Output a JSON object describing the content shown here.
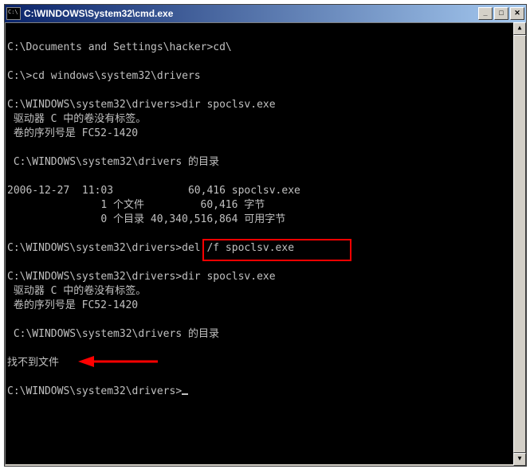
{
  "window": {
    "title": "C:\\WINDOWS\\System32\\cmd.exe"
  },
  "terminal": {
    "lines": [
      "",
      "C:\\Documents and Settings\\hacker>cd\\",
      "",
      "C:\\>cd windows\\system32\\drivers",
      "",
      "C:\\WINDOWS\\system32\\drivers>dir spoclsv.exe",
      " 驱动器 C 中的卷没有标签。",
      " 卷的序列号是 FC52-1420",
      "",
      " C:\\WINDOWS\\system32\\drivers 的目录",
      "",
      "2006-12-27  11:03            60,416 spoclsv.exe",
      "               1 个文件         60,416 字节",
      "               0 个目录 40,340,516,864 可用字节",
      "",
      "C:\\WINDOWS\\system32\\drivers>del /f spoclsv.exe",
      "",
      "C:\\WINDOWS\\system32\\drivers>dir spoclsv.exe",
      " 驱动器 C 中的卷没有标签。",
      " 卷的序列号是 FC52-1420",
      "",
      " C:\\WINDOWS\\system32\\drivers 的目录",
      "",
      "找不到文件",
      "",
      "C:\\WINDOWS\\system32\\drivers>"
    ]
  },
  "annotations": {
    "highlighted_command": "del /f spoclsv.exe",
    "arrow_target": "找不到文件"
  },
  "controls": {
    "minimize": "_",
    "maximize": "□",
    "close": "✕"
  }
}
